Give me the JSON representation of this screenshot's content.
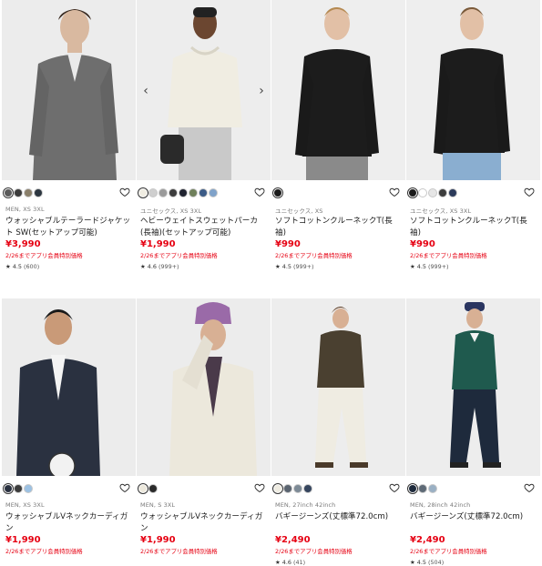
{
  "products": [
    {
      "meta": "MEN, XS 3XL",
      "name": "ウォッシャブルテーラードジャケット SW(セットアップ可能)",
      "price": "¥3,990",
      "promo": "2/26までアプリ会員特別価格",
      "rating_star": "★",
      "rating": "4.5",
      "review_count": "(600)",
      "swatches": [
        "#5a5a5a",
        "#3b3b3b",
        "#8a7f6a",
        "#2c3640"
      ],
      "bg": "#ececec"
    },
    {
      "meta": "ユニセックス, XS 3XL",
      "name": "ヘビーウェイトスウェットパーカ(長袖)(セットアップ可能)",
      "price": "¥1,990",
      "promo": "2/26までアプリ会員特別価格",
      "rating_star": "★",
      "rating": "4.6",
      "review_count": "(999+)",
      "swatches": [
        "#f0ede2",
        "#cfcfcf",
        "#9a9a9a",
        "#3c3c3c",
        "#1f2330",
        "#6e7f5a",
        "#3b5b86",
        "#7fa2c9"
      ],
      "bg": "#ededed"
    },
    {
      "meta": "ユニセックス, XS",
      "name": "ソフトコットンクルーネックT(長袖)",
      "price": "¥990",
      "promo": "2/26までアプリ会員特別価格",
      "rating_star": "★",
      "rating": "4.5",
      "review_count": "(999+)",
      "swatches": [
        "#1a1a1a"
      ],
      "bg": "#eeeeee"
    },
    {
      "meta": "ユニセックス, XS 3XL",
      "name": "ソフトコットンクルーネックT(長袖)",
      "price": "¥990",
      "promo": "2/26までアプリ会員特別価格",
      "rating_star": "★",
      "rating": "4.5",
      "review_count": "(999+)",
      "swatches": [
        "#1a1a1a",
        "#ffffff",
        "#e6e6e6",
        "#3c3c3c",
        "#2b3a5a"
      ],
      "bg": "#eeeeee"
    },
    {
      "meta": "MEN, XS 3XL",
      "name": "ウォッシャブルVネックカーディガン",
      "price": "¥1,990",
      "promo": "2/26までアプリ会員特別価格",
      "rating_star": "",
      "rating": "",
      "review_count": "",
      "swatches": [
        "#2a3140",
        "#3c3c3c",
        "#9cc1e3"
      ],
      "bg": "#ececec"
    },
    {
      "meta": "MEN, S 3XL",
      "name": "ウォッシャブルVネックカーディガン",
      "price": "¥1,990",
      "promo": "2/26までアプリ会員特別価格",
      "rating_star": "",
      "rating": "",
      "review_count": "",
      "swatches": [
        "#ece8dc",
        "#2a2a2a"
      ],
      "bg": "#ececec"
    },
    {
      "meta": "MEN, 27inch 42inch",
      "name": "バギージーンズ(丈標準72.0cm)",
      "price": "¥2,490",
      "promo": "2/26までアプリ会員特別価格",
      "rating_star": "★",
      "rating": "4.6",
      "review_count": "(41)",
      "swatches": [
        "#efece2",
        "#5a6470",
        "#7d8a96",
        "#35455e"
      ],
      "bg": "#ededed"
    },
    {
      "meta": "MEN, 28inch 42inch",
      "name": "バギージーンズ(丈標準72.0cm)",
      "price": "¥2,490",
      "promo": "2/26までアプリ会員特別価格",
      "rating_star": "★",
      "rating": "4.5",
      "review_count": "(504)",
      "swatches": [
        "#1e2a3c",
        "#5e6a76",
        "#9ab0c4"
      ],
      "bg": "#ededed"
    }
  ],
  "icons": {
    "heart": "heart-icon",
    "prev": "‹",
    "next": "›"
  },
  "colors": {
    "price": "#e60012",
    "text": "#1b1b1b",
    "meta": "#7a7a7a"
  }
}
